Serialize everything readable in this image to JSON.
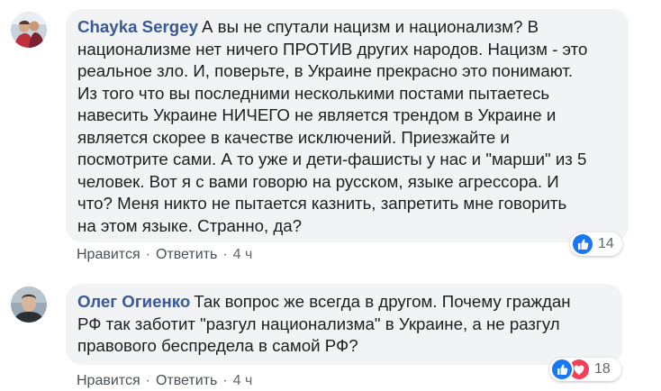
{
  "comments": [
    {
      "author": "Chayka Sergey",
      "text": "А вы не спутали нацизм и национализм? В\nнационализме нет ничего ПРОТИВ других народов. Нацизм - это\nреальное зло. И, поверьте, в Украине прекрасно это понимают.\nИз того что вы последними несколькими постами пытаетесь\nнавесить Украине НИЧЕГО не является трендом в Украине и\nявляется скорее в качестве исключений. Приезжайте и\nпосмотрите сами. А то уже и дети-фашисты у нас и \"марши\" из 5\nчеловек. Вот я с вами говорю на русском, языке агрессора. И\nчто? Меня никто не пытается казнить, запретить мне говорить\nна этом языке. Странно, да?",
      "like_label": "Нравится",
      "reply_label": "Ответить",
      "time": "4 ч",
      "reaction_count": "14",
      "reaction_icons": [
        "like-icon"
      ]
    },
    {
      "author": "Олег Огиенко",
      "text": "Так вопрос же всегда в другом. Почему граждан\nРФ так заботит \"разгул национализма\" в Украине, а не разгул\nправового беспредела в самой РФ?",
      "like_label": "Нравится",
      "reply_label": "Ответить",
      "time": "4 ч",
      "reaction_count": "18",
      "reaction_icons": [
        "like-icon",
        "love-icon"
      ]
    }
  ],
  "colors": {
    "author": "#385898",
    "bubble": "#f2f3f5",
    "like": "#1877f2",
    "love": "#f33e58"
  },
  "separator": "·"
}
